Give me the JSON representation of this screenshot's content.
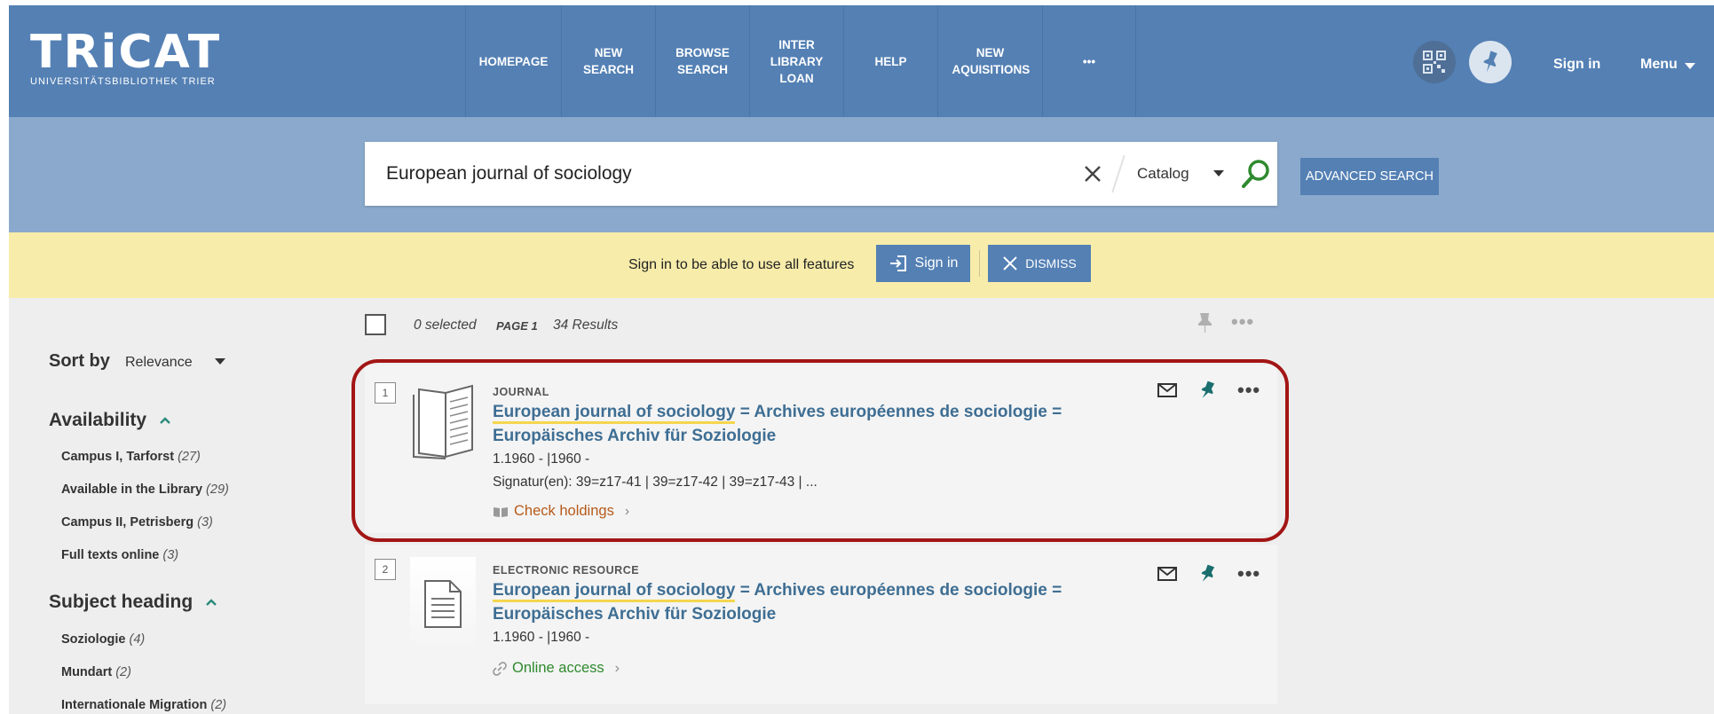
{
  "header": {
    "logo": "TRiCAT",
    "logo_subtitle": "UNIVERSITÄTSBIBLIOTHEK TRIER",
    "nav": [
      "HOMEPAGE",
      "NEW SEARCH",
      "BROWSE SEARCH",
      "INTER LIBRARY LOAN",
      "HELP",
      "NEW AQUISITIONS",
      "•••"
    ],
    "sign_in": "Sign in",
    "menu": "Menu"
  },
  "search": {
    "query": "European journal of sociology",
    "scope": "Catalog",
    "advanced_label": "ADVANCED SEARCH"
  },
  "alert": {
    "text": "Sign in to be able to use all features",
    "signin_label": "Sign in",
    "dismiss_label": "DISMISS"
  },
  "sidebar": {
    "sort_label": "Sort by",
    "sort_value": "Relevance",
    "facets": [
      {
        "title": "Availability",
        "items": [
          {
            "label": "Campus I, Tarforst",
            "count": "(27)"
          },
          {
            "label": "Available in the Library",
            "count": "(29)"
          },
          {
            "label": "Campus II, Petrisberg",
            "count": "(3)"
          },
          {
            "label": "Full texts online",
            "count": "(3)"
          }
        ]
      },
      {
        "title": "Subject heading",
        "items": [
          {
            "label": "Soziologie",
            "count": "(4)"
          },
          {
            "label": "Mundart",
            "count": "(2)"
          },
          {
            "label": "Internationale Migration",
            "count": "(2)"
          }
        ]
      }
    ]
  },
  "toolbar": {
    "selected": "0 selected",
    "page": "PAGE 1",
    "results": "34 Results"
  },
  "results": [
    {
      "number": "1",
      "type": "JOURNAL",
      "title_match": "European journal of sociology",
      "title_rest": " = Archives européennes de sociologie =",
      "title_line2": "Europäisches Archiv für Soziologie",
      "meta1": "1.1960 - |1960 -",
      "meta2": "Signatur(en): 39=z17-41 | 39=z17-42 | 39=z17-43 | ...",
      "action": "Check holdings"
    },
    {
      "number": "2",
      "type": "ELECTRONIC RESOURCE",
      "title_match": "European journal of sociology",
      "title_rest": " = Archives européennes de sociologie =",
      "title_line2": "Europäisches Archiv für Soziologie",
      "meta1": "1.1960 - |1960 -",
      "action": "Online access"
    }
  ],
  "colors": {
    "header_bg": "#5480b4",
    "search_band_bg": "#8aa9cc",
    "alert_bg": "#f7ecaa",
    "highlight_border": "#a31515",
    "title_link": "#3e6e93"
  }
}
